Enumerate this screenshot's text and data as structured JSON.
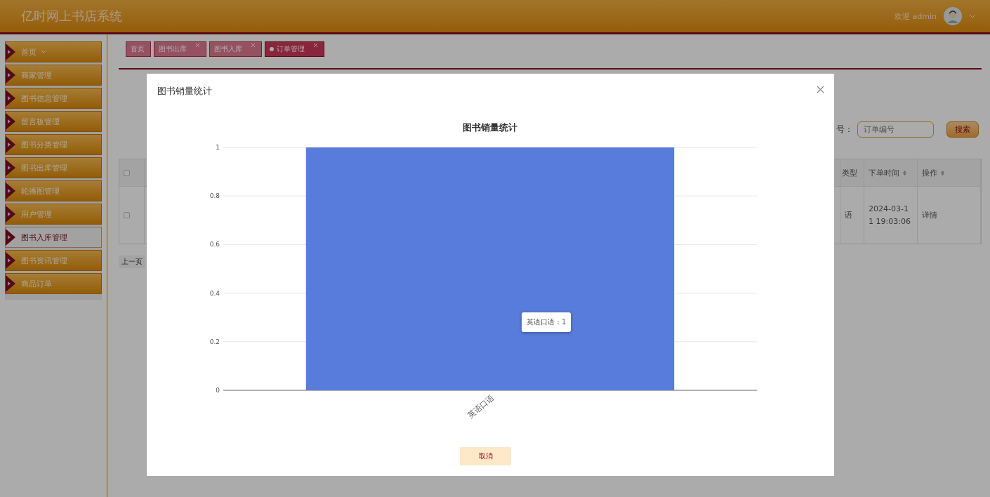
{
  "header": {
    "title": "亿时网上书店系统",
    "welcome": "欢迎 admin"
  },
  "sidebar": {
    "items": [
      {
        "label": "首页",
        "selected": false,
        "has_submenu": true
      },
      {
        "label": "商家管理",
        "selected": false,
        "has_submenu": false
      },
      {
        "label": "图书信息管理",
        "selected": false,
        "has_submenu": false
      },
      {
        "label": "留言板管理",
        "selected": false,
        "has_submenu": false
      },
      {
        "label": "图书分类管理",
        "selected": false,
        "has_submenu": false
      },
      {
        "label": "图书出库管理",
        "selected": false,
        "has_submenu": false
      },
      {
        "label": "轮播图管理",
        "selected": false,
        "has_submenu": false
      },
      {
        "label": "用户管理",
        "selected": false,
        "has_submenu": false
      },
      {
        "label": "图书入库管理",
        "selected": true,
        "has_submenu": false
      },
      {
        "label": "图书资讯管理",
        "selected": false,
        "has_submenu": false
      },
      {
        "label": "商品订单",
        "selected": false,
        "has_submenu": false
      }
    ]
  },
  "tabs": [
    {
      "label": "首页",
      "selected": false,
      "closable": false
    },
    {
      "label": "图书出库",
      "selected": false,
      "closable": true
    },
    {
      "label": "图书入库",
      "selected": false,
      "closable": true
    },
    {
      "label": "订单管理",
      "selected": true,
      "closable": true
    }
  ],
  "search": {
    "label": "号：",
    "placeholder": "订单编号",
    "button": "搜索"
  },
  "table": {
    "header_checked": false,
    "columns": [
      "类型",
      "下单时间",
      "操作"
    ],
    "rows": [
      {
        "checked": false,
        "cells": [
          "语",
          "2024-03-11 19:03:06",
          "详情"
        ]
      }
    ]
  },
  "pagination": {
    "prev": "上一页"
  },
  "modal": {
    "title": "图书销量统计",
    "tooltip": "英语口语：1",
    "cancel": "取消",
    "chart_data": {
      "type": "bar",
      "title": "图书销量统计",
      "categories": [
        "英语口语"
      ],
      "series": [
        {
          "color": "#587cdb",
          "values": [
            1
          ]
        }
      ],
      "ylim": [
        0,
        1
      ],
      "grid": true,
      "yticks": [
        0,
        0.2,
        0.4,
        0.6,
        0.8,
        1
      ]
    }
  }
}
